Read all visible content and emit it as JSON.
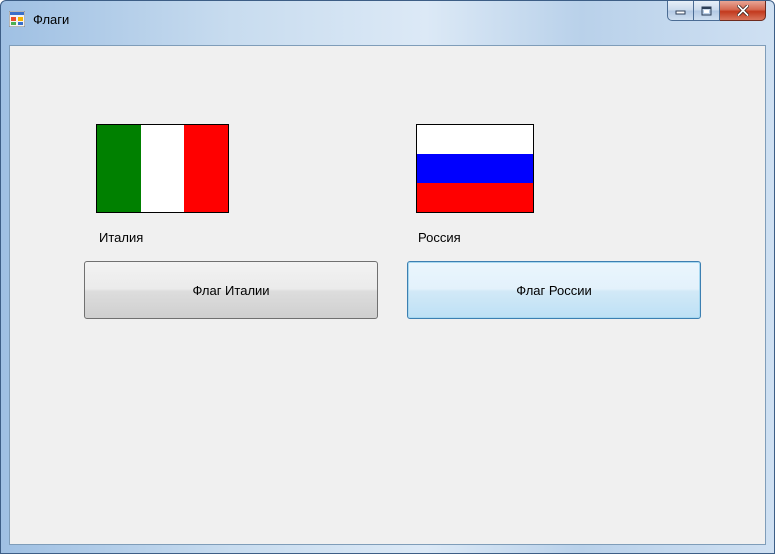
{
  "window": {
    "title": "Флаги",
    "icon": "app-form-icon",
    "caption_buttons": {
      "minimize_icon": "minimize-icon",
      "maximize_icon": "maximize-icon",
      "close_icon": "close-icon"
    }
  },
  "flags": {
    "italy": {
      "label": "Италия",
      "colors": [
        "#008000",
        "#ffffff",
        "#ff0000"
      ],
      "orientation": "vertical-stripes"
    },
    "russia": {
      "label": "Россия",
      "colors": [
        "#ffffff",
        "#0000ff",
        "#ff0000"
      ],
      "orientation": "horizontal-stripes"
    }
  },
  "buttons": {
    "italy_label": "Флаг Италии",
    "russia_label": "Флаг России"
  },
  "colors": {
    "client_background": "#f0f0f0",
    "close_button": "#c2391d"
  }
}
